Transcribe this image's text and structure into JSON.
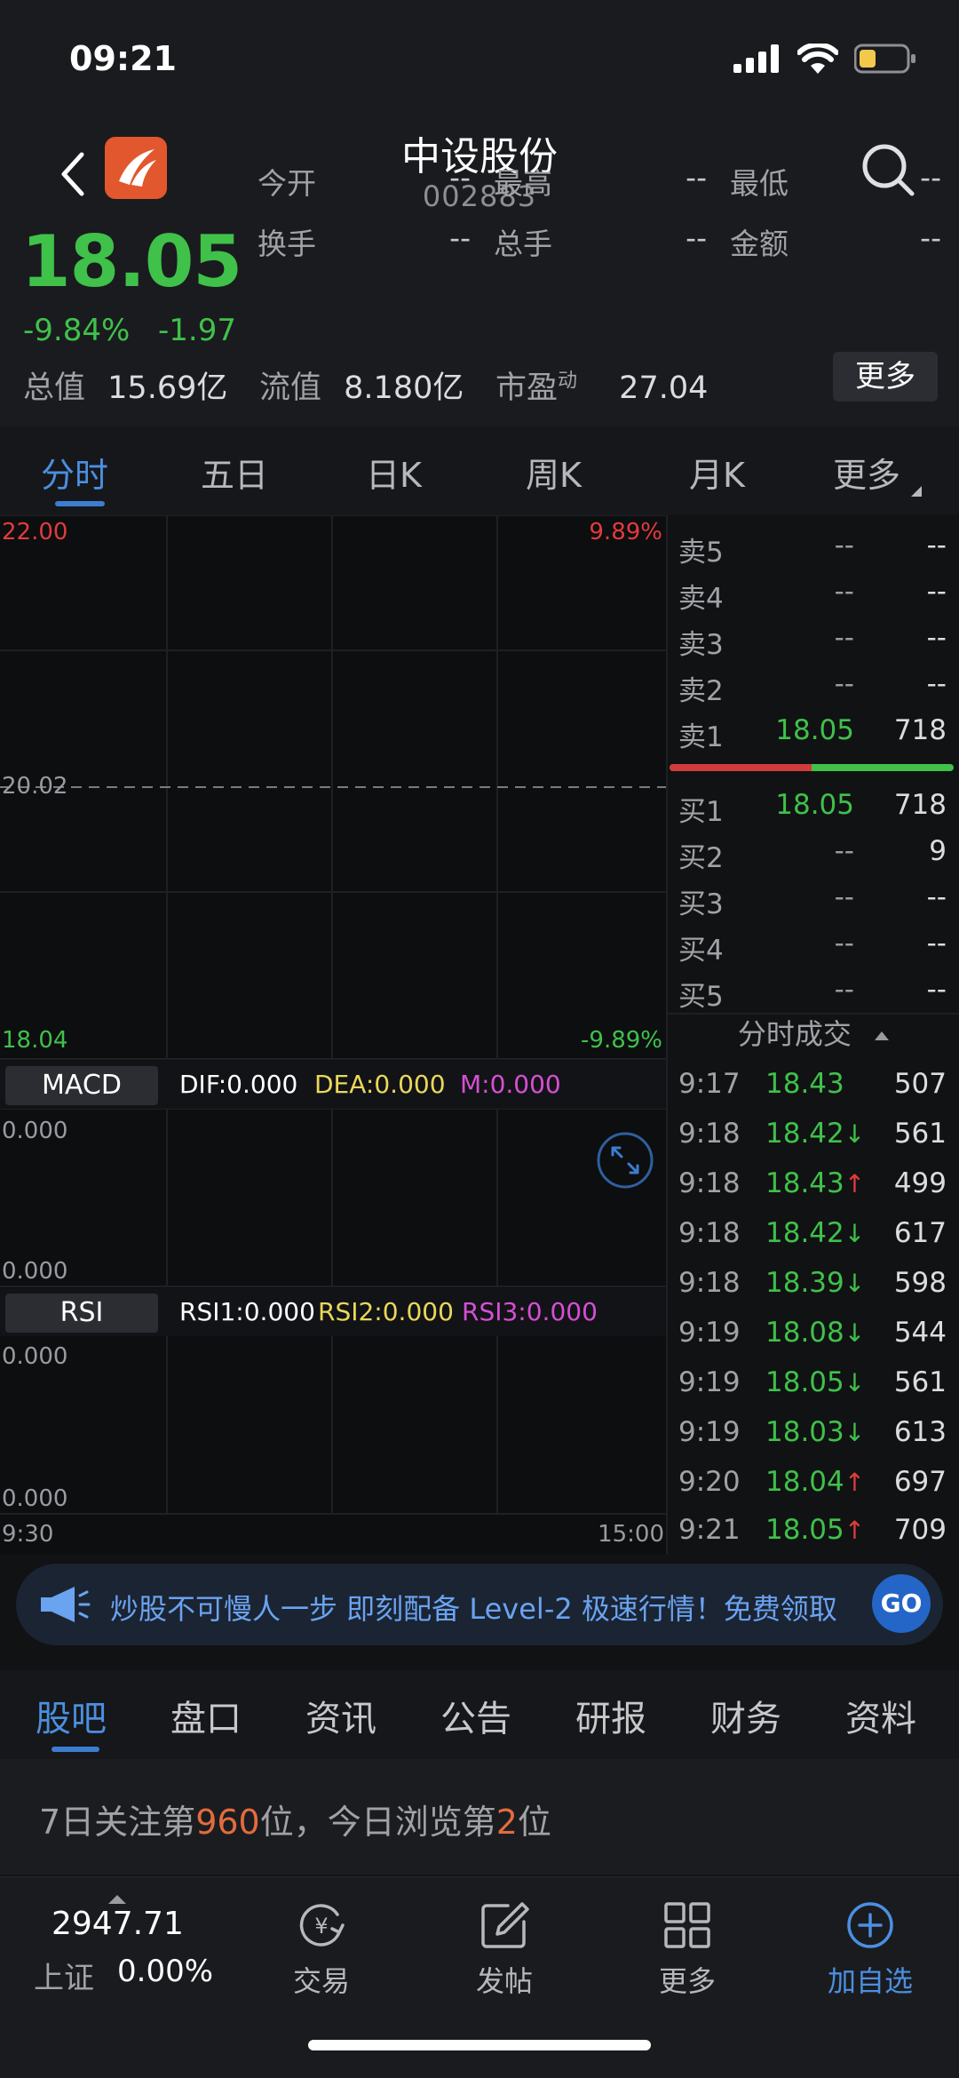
{
  "status": {
    "time": "09:21"
  },
  "stock": {
    "name": "中设股份",
    "code": "002883",
    "price": "18.05",
    "change_pct": "-9.84%",
    "change_abs": "-1.97",
    "stats": [
      {
        "label": "今开",
        "value": "--"
      },
      {
        "label": "最高",
        "value": "--"
      },
      {
        "label": "最低",
        "value": "--"
      },
      {
        "label": "换手",
        "value": "--"
      },
      {
        "label": "总手",
        "value": "--"
      },
      {
        "label": "金额",
        "value": "--"
      }
    ],
    "total_cap_label": "总值",
    "total_cap": "15.69亿",
    "float_cap_label": "流值",
    "float_cap": "8.180亿",
    "pe_label": "市盈",
    "pe_sup": "动",
    "pe": "27.04",
    "more": "更多"
  },
  "period_tabs": [
    "分时",
    "五日",
    "日K",
    "周K",
    "月K",
    "更多"
  ],
  "chart": {
    "price_top": "22.00",
    "pct_top": "9.89%",
    "price_mid": "20.02",
    "price_bottom": "18.04",
    "pct_bottom": "-9.89%",
    "macd": {
      "label": "MACD",
      "dif": "DIF:0.000",
      "dea": "DEA:0.000",
      "m": "M:0.000",
      "top": "0.000",
      "bottom": "0.000"
    },
    "rsi": {
      "label": "RSI",
      "rsi1": "RSI1:0.000",
      "rsi2": "RSI2:0.000",
      "rsi3": "RSI3:0.000",
      "top": "0.000",
      "bottom": "0.000"
    },
    "time_start": "9:30",
    "time_end": "15:00"
  },
  "order_book": {
    "asks": [
      {
        "label": "卖5",
        "price": "--",
        "vol": "--"
      },
      {
        "label": "卖4",
        "price": "--",
        "vol": "--"
      },
      {
        "label": "卖3",
        "price": "--",
        "vol": "--"
      },
      {
        "label": "卖2",
        "price": "--",
        "vol": "--"
      },
      {
        "label": "卖1",
        "price": "18.05",
        "vol": "718"
      }
    ],
    "bids": [
      {
        "label": "买1",
        "price": "18.05",
        "vol": "718"
      },
      {
        "label": "买2",
        "price": "--",
        "vol": "9"
      },
      {
        "label": "买3",
        "price": "--",
        "vol": "--"
      },
      {
        "label": "买4",
        "price": "--",
        "vol": "--"
      },
      {
        "label": "买5",
        "price": "--",
        "vol": "--"
      }
    ],
    "bid_ratio": 0.5
  },
  "ticks": {
    "title": "分时成交",
    "rows": [
      {
        "time": "9:17",
        "price": "18.43",
        "arrow": "",
        "vol": "507"
      },
      {
        "time": "9:18",
        "price": "18.42",
        "arrow": "↓",
        "vol": "561"
      },
      {
        "time": "9:18",
        "price": "18.43",
        "arrow": "↑",
        "vol": "499"
      },
      {
        "time": "9:18",
        "price": "18.42",
        "arrow": "↓",
        "vol": "617"
      },
      {
        "time": "9:18",
        "price": "18.39",
        "arrow": "↓",
        "vol": "598"
      },
      {
        "time": "9:19",
        "price": "18.08",
        "arrow": "↓",
        "vol": "544"
      },
      {
        "time": "9:19",
        "price": "18.05",
        "arrow": "↓",
        "vol": "561"
      },
      {
        "time": "9:19",
        "price": "18.03",
        "arrow": "↓",
        "vol": "613"
      },
      {
        "time": "9:20",
        "price": "18.04",
        "arrow": "↑",
        "vol": "697"
      },
      {
        "time": "9:21",
        "price": "18.05",
        "arrow": "↑",
        "vol": "709"
      }
    ]
  },
  "banner": {
    "text": "炒股不可慢人一步 即刻配备 Level-2 极速行情！免费领取",
    "go": "GO"
  },
  "section_tabs": [
    "股吧",
    "盘口",
    "资讯",
    "公告",
    "研报",
    "财务",
    "资料"
  ],
  "rank": {
    "p1": "7日关注第",
    "n1": "960",
    "p2": "位，今日浏览第",
    "n2": "2",
    "p3": "位"
  },
  "bottom_nav": {
    "index_value": "2947.71",
    "index_name": "上证",
    "index_change": "0.00%",
    "items": [
      "交易",
      "发帖",
      "更多",
      "加自选"
    ]
  },
  "colors": {
    "up": "#e23b3b",
    "down": "#3fc14a",
    "accent": "#4b8fe0",
    "logo": "#e2572d"
  }
}
